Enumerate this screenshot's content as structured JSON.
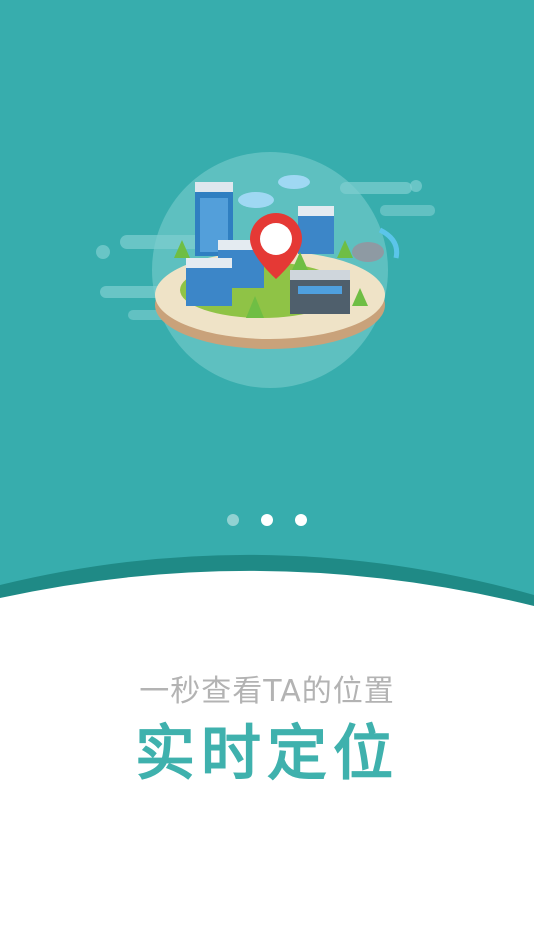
{
  "colors": {
    "brand_teal": "#37adad",
    "wave_dark_teal": "#1f8a86",
    "title_teal": "#3fb1ad",
    "subtitle_gray": "#b3b3b3",
    "background_white": "#ffffff"
  },
  "pager": {
    "page_count": 3,
    "active_index": 1
  },
  "illustration": {
    "icon": "city-location-pin-illustration"
  },
  "onboarding": {
    "subtitle": "一秒查看TA的位置",
    "title": "实时定位"
  }
}
